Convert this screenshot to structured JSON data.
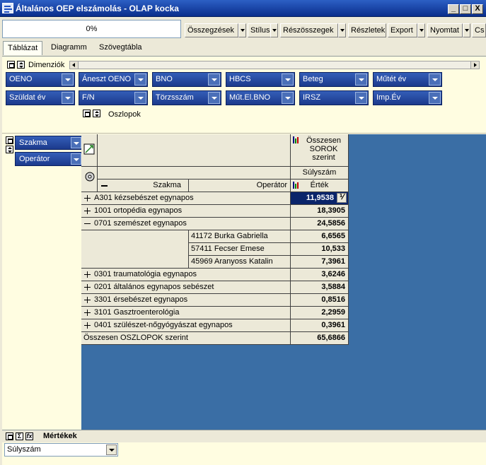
{
  "window": {
    "title": "Általános OEP elszámolás - OLAP kocka",
    "min": "_",
    "max": "□",
    "close": "X"
  },
  "toolbar": {
    "progress": "0%",
    "buttons": [
      "Összegzések",
      "Stílus",
      "Részösszegek",
      "Részletek",
      "Export",
      "Nyomtat",
      "Cs"
    ]
  },
  "tabs": [
    "Táblázat",
    "Diagramm",
    "Szövegtábla"
  ],
  "dimensions": {
    "label": "Dimenziók",
    "row1": [
      "OENO",
      "Áneszt OENO",
      "BNO",
      "HBCS",
      "Beteg",
      "Műtét év"
    ],
    "row2": [
      "Szüldat év",
      "F/N",
      "Törzsszám",
      "Műt.El.BNO",
      "IRSZ",
      "Imp.Év"
    ]
  },
  "columns_label": "Oszlopok",
  "row_dims": [
    "Szakma",
    "Operátor"
  ],
  "pivot": {
    "col_header": "Összesen SOROK szerint",
    "measure": "Súlyszám",
    "value_header": "Érték",
    "row_header_1": "Szakma",
    "row_header_2": "Operátor",
    "rows": [
      {
        "label": "A301 kézsebészet egynapos",
        "value": "11,9538",
        "expand": "+"
      },
      {
        "label": "1001 ortopédia egynapos",
        "value": "18,3905",
        "expand": "+"
      },
      {
        "label": "0701 szemészet egynapos",
        "value": "24,5856",
        "expand": "-"
      },
      {
        "label": "0301 traumatológia egynapos",
        "value": "3,6246",
        "expand": "+"
      },
      {
        "label": "0201 általános egynapos sebészet",
        "value": "3,5884",
        "expand": "+"
      },
      {
        "label": "3301 érsebészet egynapos",
        "value": "0,8516",
        "expand": "+"
      },
      {
        "label": "3101 Gasztroenterológia",
        "value": "2,2959",
        "expand": "+"
      },
      {
        "label": "0401 szülészet-nőgyógyászat egynapos",
        "value": "0,3961",
        "expand": "+"
      }
    ],
    "sub_rows": [
      {
        "label": "41172 Burka Gabriella",
        "value": "6,6565"
      },
      {
        "label": "57411 Fecser Emese",
        "value": "10,533"
      },
      {
        "label": "45969 Aranyoss Katalin",
        "value": "7,3961"
      }
    ],
    "total_label": "Összesen OSZLOPOK szerint",
    "total_value": "65,6866"
  },
  "measures": {
    "label": "Mértékek",
    "selected": "Súlyszám"
  }
}
